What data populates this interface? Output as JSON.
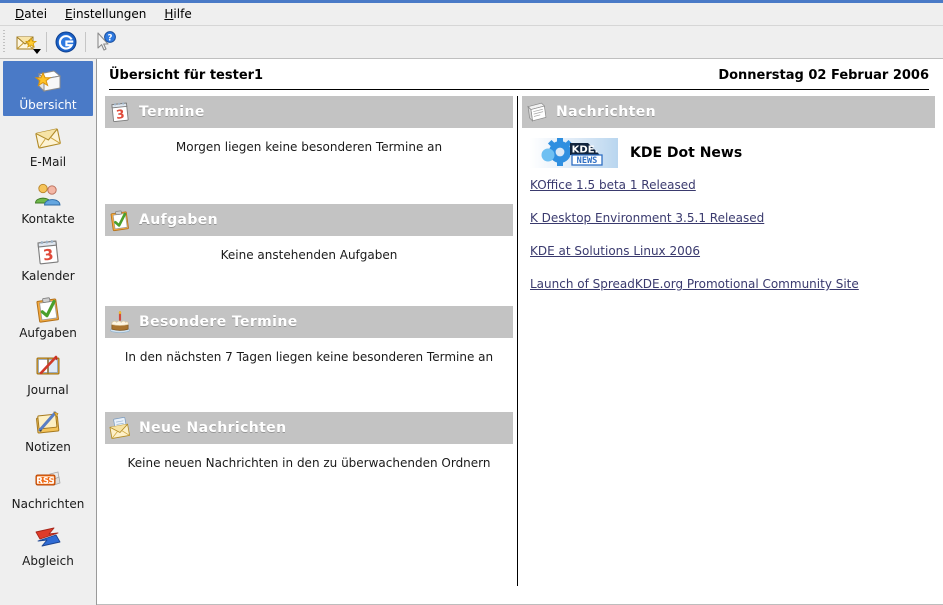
{
  "window": {
    "accent_color": "#4a7ac7",
    "selection_color": "#4a7ac7",
    "section_header_bg": "#c3c3c3",
    "link_color": "#3a3a6e"
  },
  "menubar": {
    "items": [
      {
        "label": "Datei",
        "accel": "D",
        "rest": "atei"
      },
      {
        "label": "Einstellungen",
        "accel": "E",
        "rest": "instellungen"
      },
      {
        "label": "Hilfe",
        "accel": "H",
        "rest": "ilfe"
      }
    ]
  },
  "toolbar": {
    "buttons": [
      {
        "name": "new-message-button",
        "icon": "new-message-icon",
        "has_dropdown": true
      },
      {
        "name": "go-kontact-button",
        "icon": "globe-g-icon",
        "has_dropdown": false
      },
      {
        "name": "whats-this-button",
        "icon": "whats-this-icon",
        "has_dropdown": false
      }
    ]
  },
  "sidebar": {
    "items": [
      {
        "label": "Übersicht",
        "icon": "summary-icon",
        "selected": true
      },
      {
        "label": "E-Mail",
        "icon": "mail-icon",
        "selected": false
      },
      {
        "label": "Kontakte",
        "icon": "contacts-icon",
        "selected": false
      },
      {
        "label": "Kalender",
        "icon": "calendar-icon",
        "selected": false
      },
      {
        "label": "Aufgaben",
        "icon": "todo-icon",
        "selected": false
      },
      {
        "label": "Journal",
        "icon": "journal-icon",
        "selected": false
      },
      {
        "label": "Notizen",
        "icon": "notes-icon",
        "selected": false
      },
      {
        "label": "Nachrichten",
        "icon": "rss-icon",
        "selected": false
      },
      {
        "label": "Abgleich",
        "icon": "sync-icon",
        "selected": false
      }
    ]
  },
  "summary": {
    "title": "Übersicht für tester1",
    "date": "Donnerstag 02 Februar 2006",
    "left_sections": [
      {
        "title": "Termine",
        "icon": "calendar-icon",
        "body": "Morgen liegen keine besonderen Termine an"
      },
      {
        "title": "Aufgaben",
        "icon": "todo-icon",
        "body": "Keine anstehenden Aufgaben"
      },
      {
        "title": "Besondere Termine",
        "icon": "birthday-cake-icon",
        "body": "In den nächsten 7 Tagen liegen keine besonderen Termine an"
      },
      {
        "title": "Neue Nachrichten",
        "icon": "new-mail-icon",
        "body": "Keine neuen Nachrichten in den zu überwachenden Ordnern"
      }
    ],
    "news": {
      "title": "Nachrichten",
      "icon": "newspaper-icon",
      "feed": {
        "name": "KDE Dot News",
        "logo": "kde-dot-news-logo",
        "logo_text_main": "KDE.",
        "logo_text_sub": "NEWS"
      },
      "links": [
        "KOffice 1.5 beta 1 Released",
        "K Desktop Environment 3.5.1 Released",
        "KDE at Solutions Linux 2006",
        "Launch of SpreadKDE.org Promotional Community Site"
      ]
    }
  }
}
